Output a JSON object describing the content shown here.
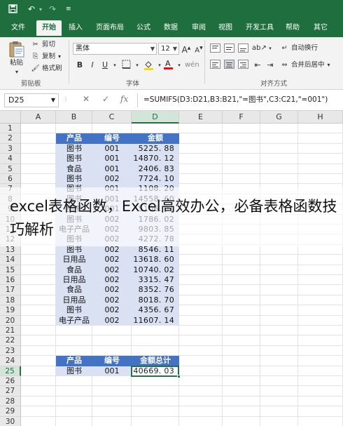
{
  "quick_access": {
    "save_icon": "save-icon",
    "undo_icon": "undo-icon",
    "redo_icon": "redo-icon",
    "customize_icon": "customize-qat-icon"
  },
  "tabs": [
    {
      "label": "文件",
      "active": false
    },
    {
      "label": "开始",
      "active": true
    },
    {
      "label": "插入",
      "active": false
    },
    {
      "label": "页面布局",
      "active": false
    },
    {
      "label": "公式",
      "active": false
    },
    {
      "label": "数据",
      "active": false
    },
    {
      "label": "审阅",
      "active": false
    },
    {
      "label": "视图",
      "active": false
    },
    {
      "label": "开发工具",
      "active": false
    },
    {
      "label": "帮助",
      "active": false
    },
    {
      "label": "其它",
      "active": false
    }
  ],
  "ribbon": {
    "clipboard": {
      "paste": "粘贴",
      "cut": "剪切",
      "copy": "复制",
      "format_painter": "格式刷",
      "group": "剪贴板"
    },
    "font": {
      "name": "黑体",
      "size": "12",
      "group": "字体"
    },
    "alignment": {
      "wrap": "自动换行",
      "merge": "合并后居中",
      "group": "对齐方式"
    }
  },
  "formula_bar": {
    "name_box": "D25",
    "formula": "=SUMIFS(D3:D21,B3:B21,\"=图书\",C3:C21,\"=001\")"
  },
  "sheet": {
    "columns": [
      "A",
      "B",
      "C",
      "D",
      "E",
      "F",
      "G",
      "H"
    ],
    "rows": [
      "1",
      "2",
      "3",
      "4",
      "5",
      "6",
      "7",
      "8",
      "9",
      "10",
      "11",
      "12",
      "13",
      "14",
      "15",
      "16",
      "17",
      "18",
      "19",
      "20",
      "21",
      "22",
      "23",
      "24",
      "25",
      "26",
      "27",
      "28",
      "29",
      "30"
    ],
    "table_header": [
      "产品",
      "编号",
      "金额"
    ],
    "table_rows": [
      [
        "图书",
        "001",
        "5225. 88"
      ],
      [
        "图书",
        "001",
        "14870. 12"
      ],
      [
        "食品",
        "001",
        "2406. 83"
      ],
      [
        "图书",
        "002",
        "7724. 10"
      ],
      [
        "图书",
        "001",
        "1108. 20"
      ],
      [
        "图书",
        "001",
        "14558. 60"
      ],
      [
        "图书",
        "001",
        "5106. 01"
      ],
      [
        "图书",
        "002",
        "1786. 02"
      ],
      [
        "电子产品",
        "002",
        "9803. 85"
      ],
      [
        "图书",
        "002",
        "4272. 78"
      ],
      [
        "图书",
        "002",
        "8546. 11"
      ],
      [
        "日用品",
        "002",
        "13618. 60"
      ],
      [
        "食品",
        "002",
        "10740. 02"
      ],
      [
        "日用品",
        "002",
        "3315. 47"
      ],
      [
        "食品",
        "002",
        "8352. 76"
      ],
      [
        "日用品",
        "002",
        "8018. 70"
      ],
      [
        "图书",
        "002",
        "4356. 67"
      ],
      [
        "电子产品",
        "002",
        "11607. 14"
      ]
    ],
    "summary_header": [
      "产品",
      "编号",
      "金额总计"
    ],
    "summary_row": [
      "图书",
      "001",
      "40669. 03"
    ]
  },
  "overlay_text": "excel表格函数，Excel高效办公，必备表格函数技巧解析",
  "colors": {
    "excel_green": "#1e6f3d",
    "header_blue": "#4472c4",
    "body_blue": "#d9e1f2"
  }
}
